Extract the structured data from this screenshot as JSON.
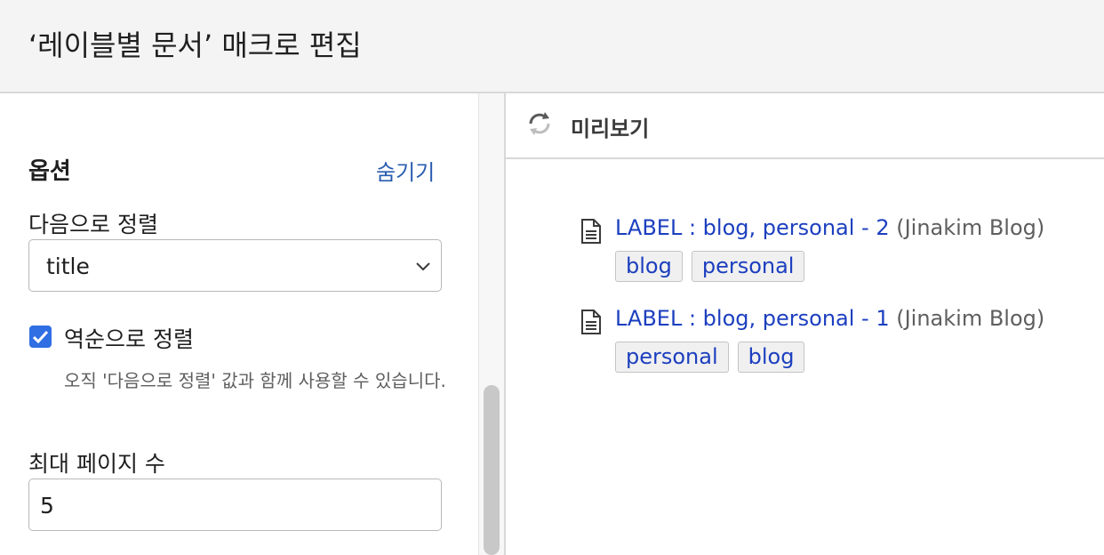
{
  "dialog": {
    "title": "‘레이블별 문서’ 매크로 편집"
  },
  "options": {
    "heading": "옵션",
    "hide_link": "숨기기",
    "sort_by_label": "다음으로 정렬",
    "sort_by_value": "title",
    "reverse_sort_label": "역순으로 정렬",
    "reverse_sort_checked": true,
    "reverse_sort_help": "오직 '다음으로 정렬' 값과 함께 사용할 수 있습니다.",
    "max_pages_label": "최대 페이지 수",
    "max_pages_value": "5"
  },
  "preview": {
    "title": "미리보기",
    "results": [
      {
        "title": "LABEL : blog, personal - 2",
        "space": "(Jinakim Blog)",
        "labels": [
          "blog",
          "personal"
        ]
      },
      {
        "title": "LABEL : blog, personal - 1",
        "space": "(Jinakim Blog)",
        "labels": [
          "personal",
          "blog"
        ]
      }
    ]
  },
  "icons": {
    "refresh": "refresh-icon",
    "page": "page-icon",
    "chevron": "chevron-down-icon",
    "check": "check-icon"
  },
  "colors": {
    "link": "#1c3fbf",
    "hide_link": "#2a5db0",
    "checkbox": "#2f6ee3",
    "header_bg": "#f4f4f4"
  }
}
